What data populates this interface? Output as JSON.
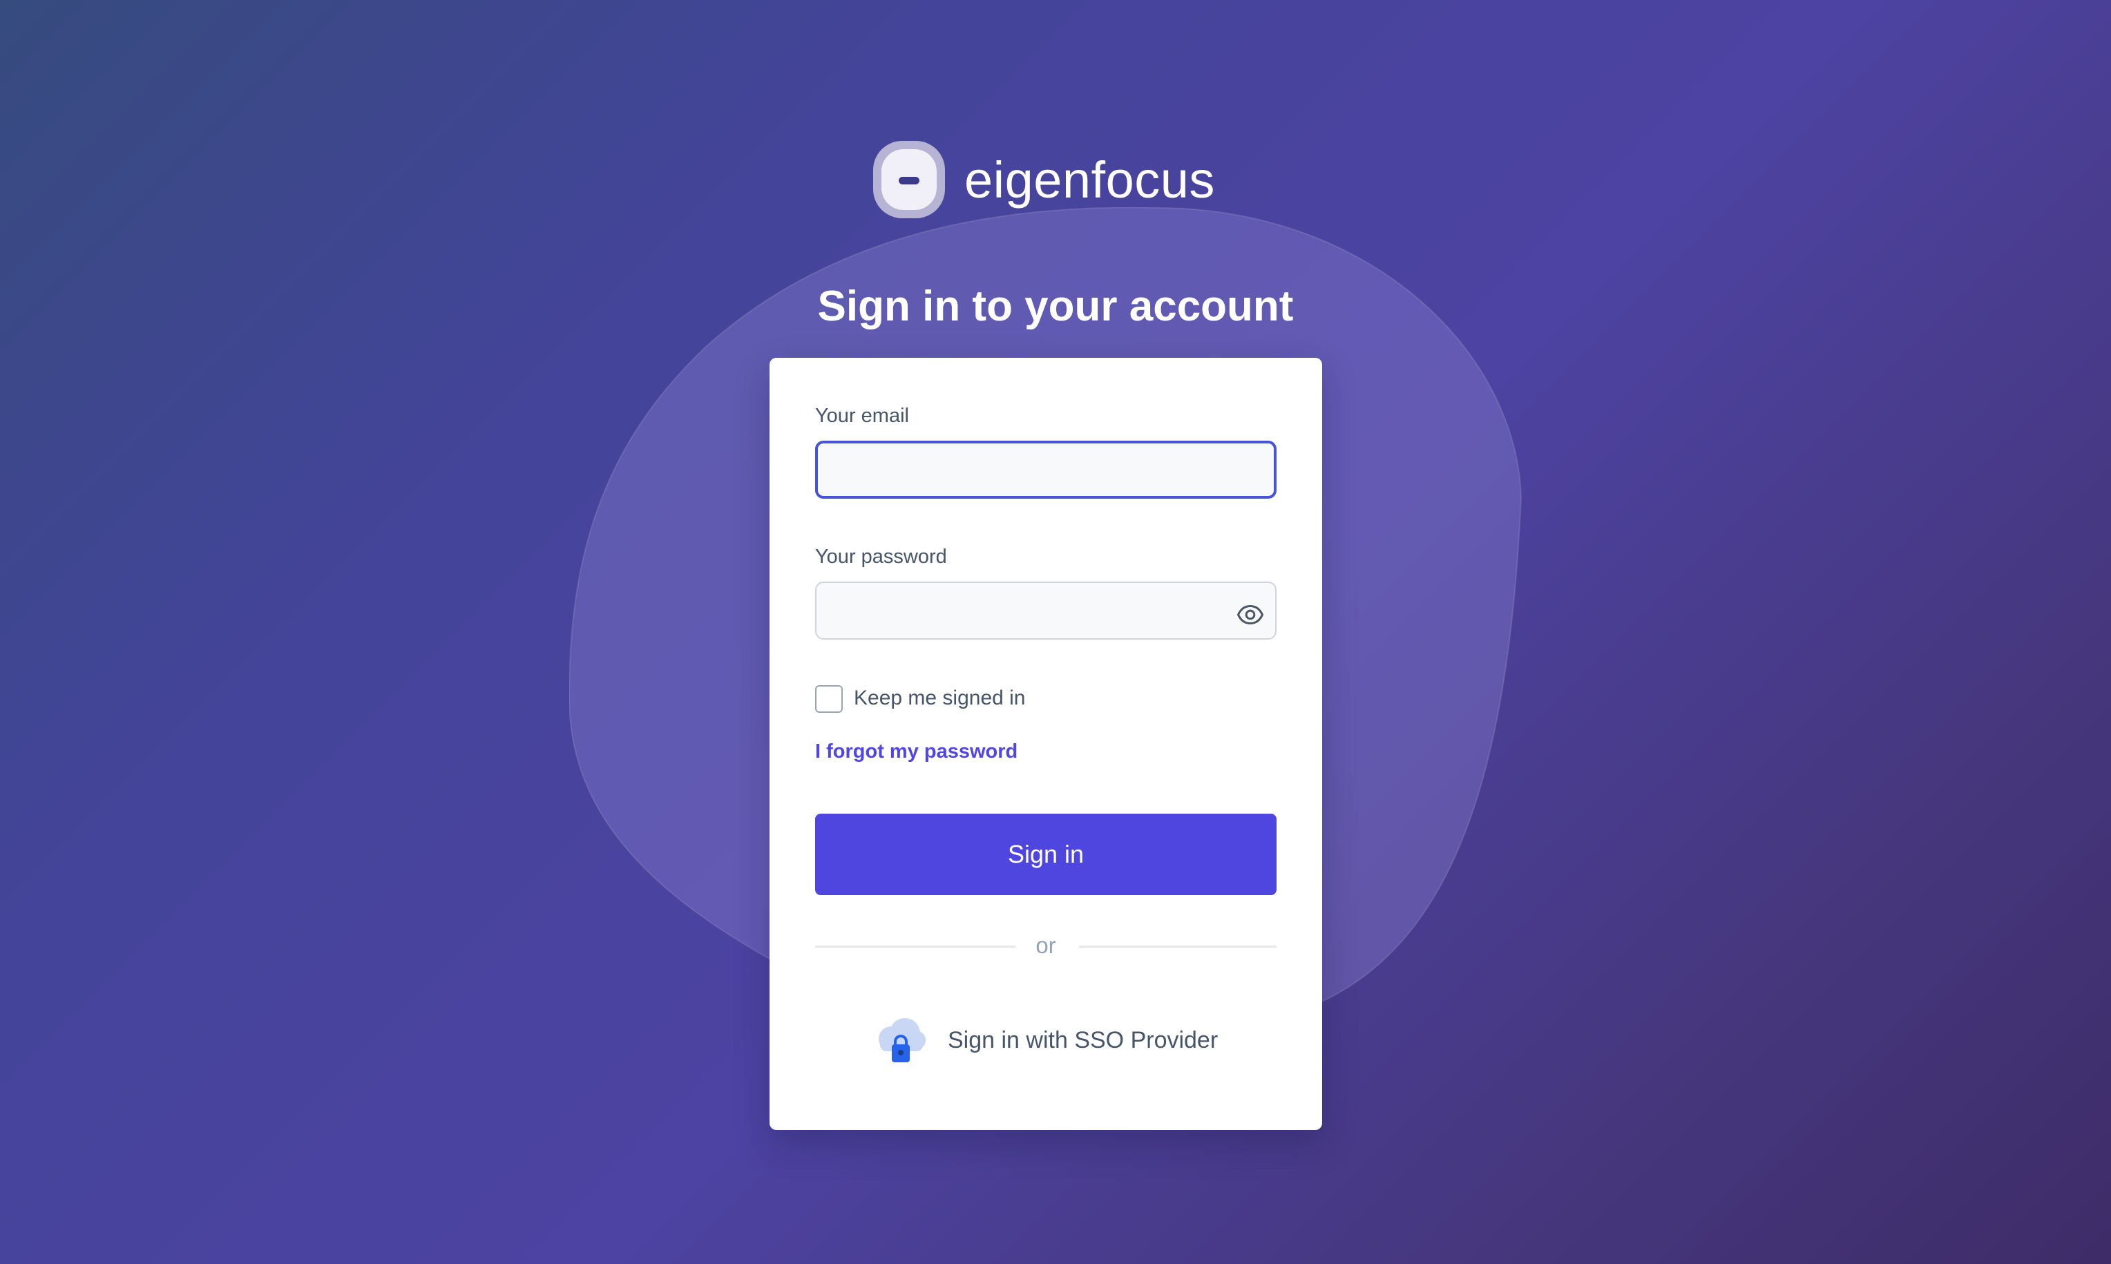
{
  "brand": {
    "name": "eigenfocus",
    "logo_icon": "eigenfocus-logo-icon"
  },
  "heading": "Sign in to your account",
  "form": {
    "email": {
      "label": "Your email",
      "value": "",
      "placeholder": ""
    },
    "password": {
      "label": "Your password",
      "value": "",
      "placeholder": "",
      "toggle_icon": "eye-icon"
    },
    "remember": {
      "label": "Keep me signed in",
      "checked": false
    },
    "forgot_link": "I forgot my password",
    "submit_label": "Sign in",
    "divider_text": "or",
    "sso": {
      "label": "Sign in with SSO Provider",
      "icon": "cloud-lock-icon"
    }
  },
  "colors": {
    "accent": "#4f46e0",
    "link": "#4f46e5",
    "focus_border": "#4654d6",
    "background_start": "#364b7e",
    "background_end": "#3e2c68"
  }
}
